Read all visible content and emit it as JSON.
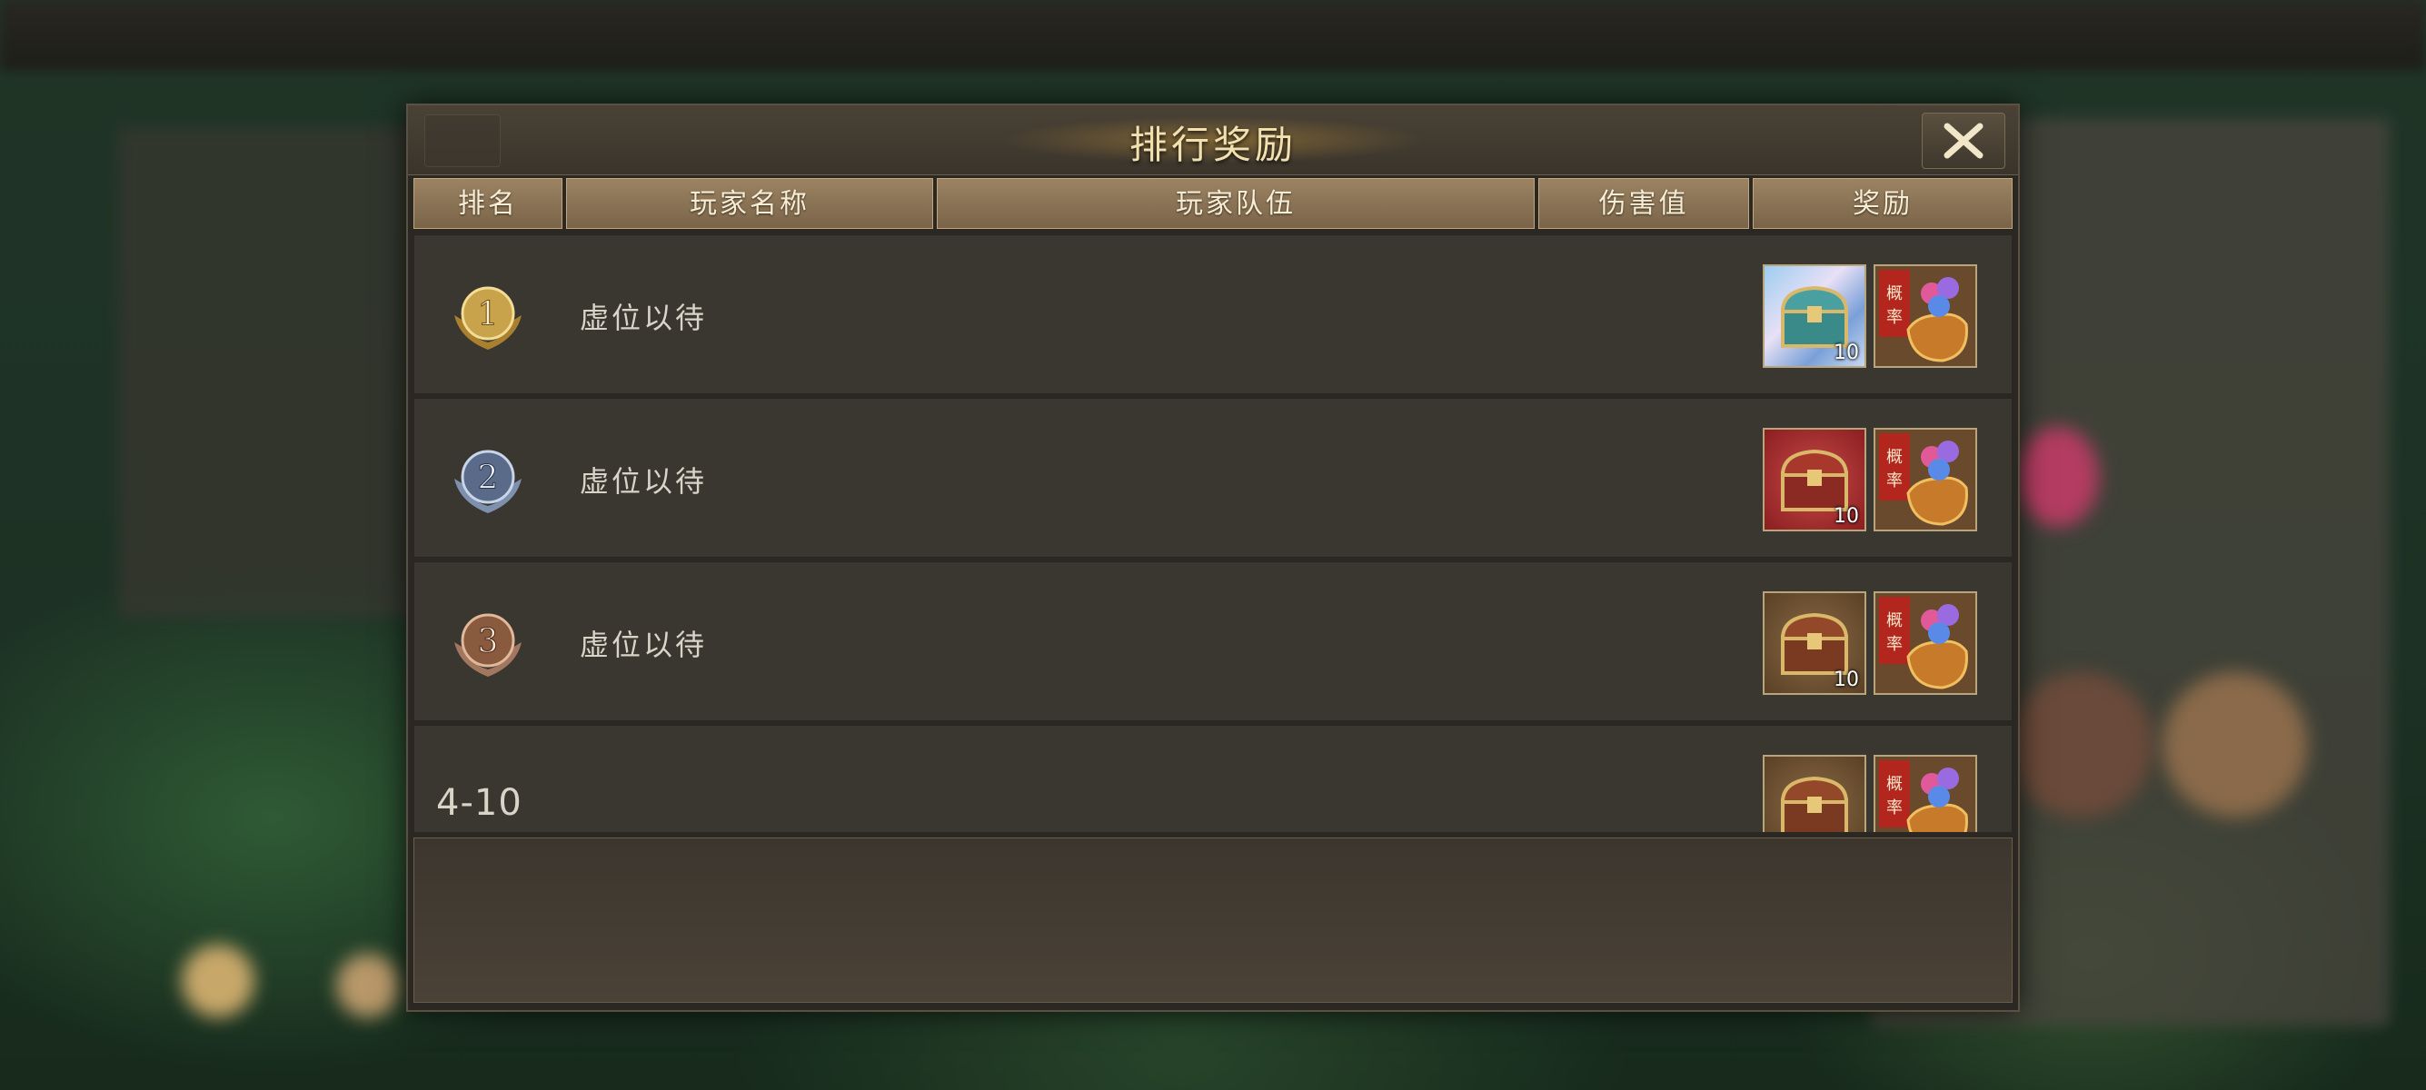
{
  "dialog": {
    "title": "排行奖励",
    "columns": [
      "排名",
      "玩家名称",
      "玩家队伍",
      "伤害值",
      "奖励"
    ]
  },
  "rows": [
    {
      "rank": "1",
      "player": "虚位以待",
      "chest_count": "10",
      "chest_style": "rainbow",
      "badge_color": "#c9a24c"
    },
    {
      "rank": "2",
      "player": "虚位以待",
      "chest_count": "10",
      "chest_style": "red",
      "badge_color": "#5a6b8a"
    },
    {
      "rank": "3",
      "player": "虚位以待",
      "chest_count": "10",
      "chest_style": "bronze",
      "badge_color": "#8a5a3e"
    },
    {
      "rank": "4-10",
      "player": "",
      "chest_count": "",
      "chest_style": "bronze",
      "badge_color": ""
    }
  ],
  "rewards": {
    "chest_icon": "treasure-chest-icon",
    "bag_icon": "probability-gift-bag-icon",
    "bag_label": "概率"
  }
}
